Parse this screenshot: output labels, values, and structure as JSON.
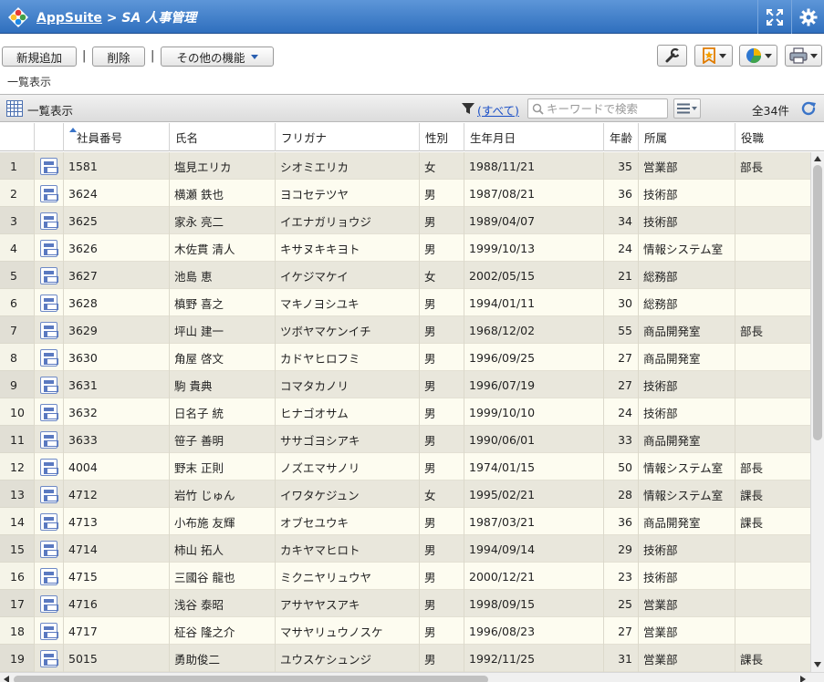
{
  "header": {
    "app_link": "AppSuite",
    "separator": ">",
    "app_name": "SA 人事管理"
  },
  "toolbar": {
    "add_label": "新規追加",
    "delete_label": "削除",
    "pipe": "|",
    "more_label": "その他の機能"
  },
  "view_label": "一覧表示",
  "panel": {
    "title": "一覧表示",
    "filter_label": "(すべて)",
    "search_placeholder": "キーワードで検索",
    "count": "全34件"
  },
  "columns": [
    "社員番号",
    "氏名",
    "フリガナ",
    "性別",
    "生年月日",
    "年齢",
    "所属",
    "役職"
  ],
  "rows": [
    {
      "n": "1",
      "id": "1581",
      "name": "塩見エリカ",
      "kana": "シオミエリカ",
      "sex": "女",
      "dob": "1988/11/21",
      "age": "35",
      "dept": "営業部",
      "pos": "部長"
    },
    {
      "n": "2",
      "id": "3624",
      "name": "横瀬 鉄也",
      "kana": "ヨコセテツヤ",
      "sex": "男",
      "dob": "1987/08/21",
      "age": "36",
      "dept": "技術部",
      "pos": ""
    },
    {
      "n": "3",
      "id": "3625",
      "name": "家永 亮二",
      "kana": "イエナガリョウジ",
      "sex": "男",
      "dob": "1989/04/07",
      "age": "34",
      "dept": "技術部",
      "pos": ""
    },
    {
      "n": "4",
      "id": "3626",
      "name": "木佐貫 清人",
      "kana": "キサヌキキヨト",
      "sex": "男",
      "dob": "1999/10/13",
      "age": "24",
      "dept": "情報システム室",
      "pos": ""
    },
    {
      "n": "5",
      "id": "3627",
      "name": "池島 恵",
      "kana": "イケジマケイ",
      "sex": "女",
      "dob": "2002/05/15",
      "age": "21",
      "dept": "総務部",
      "pos": ""
    },
    {
      "n": "6",
      "id": "3628",
      "name": "槙野 喜之",
      "kana": "マキノヨシユキ",
      "sex": "男",
      "dob": "1994/01/11",
      "age": "30",
      "dept": "総務部",
      "pos": ""
    },
    {
      "n": "7",
      "id": "3629",
      "name": "坪山 建一",
      "kana": "ツボヤマケンイチ",
      "sex": "男",
      "dob": "1968/12/02",
      "age": "55",
      "dept": "商品開発室",
      "pos": "部長"
    },
    {
      "n": "8",
      "id": "3630",
      "name": "角屋 啓文",
      "kana": "カドヤヒロフミ",
      "sex": "男",
      "dob": "1996/09/25",
      "age": "27",
      "dept": "商品開発室",
      "pos": ""
    },
    {
      "n": "9",
      "id": "3631",
      "name": "駒 貴典",
      "kana": "コマタカノリ",
      "sex": "男",
      "dob": "1996/07/19",
      "age": "27",
      "dept": "技術部",
      "pos": ""
    },
    {
      "n": "10",
      "id": "3632",
      "name": "日名子 統",
      "kana": "ヒナゴオサム",
      "sex": "男",
      "dob": "1999/10/10",
      "age": "24",
      "dept": "技術部",
      "pos": ""
    },
    {
      "n": "11",
      "id": "3633",
      "name": "笹子 善明",
      "kana": "ササゴヨシアキ",
      "sex": "男",
      "dob": "1990/06/01",
      "age": "33",
      "dept": "商品開発室",
      "pos": ""
    },
    {
      "n": "12",
      "id": "4004",
      "name": "野末 正則",
      "kana": "ノズエマサノリ",
      "sex": "男",
      "dob": "1974/01/15",
      "age": "50",
      "dept": "情報システム室",
      "pos": "部長"
    },
    {
      "n": "13",
      "id": "4712",
      "name": "岩竹 じゅん",
      "kana": "イワタケジュン",
      "sex": "女",
      "dob": "1995/02/21",
      "age": "28",
      "dept": "情報システム室",
      "pos": "課長"
    },
    {
      "n": "14",
      "id": "4713",
      "name": "小布施 友輝",
      "kana": "オブセユウキ",
      "sex": "男",
      "dob": "1987/03/21",
      "age": "36",
      "dept": "商品開発室",
      "pos": "課長"
    },
    {
      "n": "15",
      "id": "4714",
      "name": "柿山 拓人",
      "kana": "カキヤマヒロト",
      "sex": "男",
      "dob": "1994/09/14",
      "age": "29",
      "dept": "技術部",
      "pos": ""
    },
    {
      "n": "16",
      "id": "4715",
      "name": "三國谷 龍也",
      "kana": "ミクニヤリュウヤ",
      "sex": "男",
      "dob": "2000/12/21",
      "age": "23",
      "dept": "技術部",
      "pos": ""
    },
    {
      "n": "17",
      "id": "4716",
      "name": "浅谷 泰昭",
      "kana": "アサヤヤスアキ",
      "sex": "男",
      "dob": "1998/09/15",
      "age": "25",
      "dept": "営業部",
      "pos": ""
    },
    {
      "n": "18",
      "id": "4717",
      "name": "柾谷 隆之介",
      "kana": "マサヤリュウノスケ",
      "sex": "男",
      "dob": "1996/08/23",
      "age": "27",
      "dept": "営業部",
      "pos": ""
    },
    {
      "n": "19",
      "id": "5015",
      "name": "勇助俊二",
      "kana": "ユウスケシュンジ",
      "sex": "男",
      "dob": "1992/11/25",
      "age": "31",
      "dept": "営業部",
      "pos": "課長"
    }
  ],
  "colors": {
    "titlebar": "#2f6fbe",
    "row_odd": "#e9e7dc",
    "row_even": "#fdfcf0",
    "link": "#1a4fc7"
  },
  "icons": [
    "appsuite-logo-icon",
    "fullscreen-icon",
    "gear-icon",
    "wrench-icon",
    "bookmark-star-icon",
    "pie-chart-icon",
    "printer-icon",
    "grid-icon",
    "filter-icon",
    "search-icon",
    "list-menu-icon",
    "refresh-icon",
    "detail-record-icon"
  ]
}
